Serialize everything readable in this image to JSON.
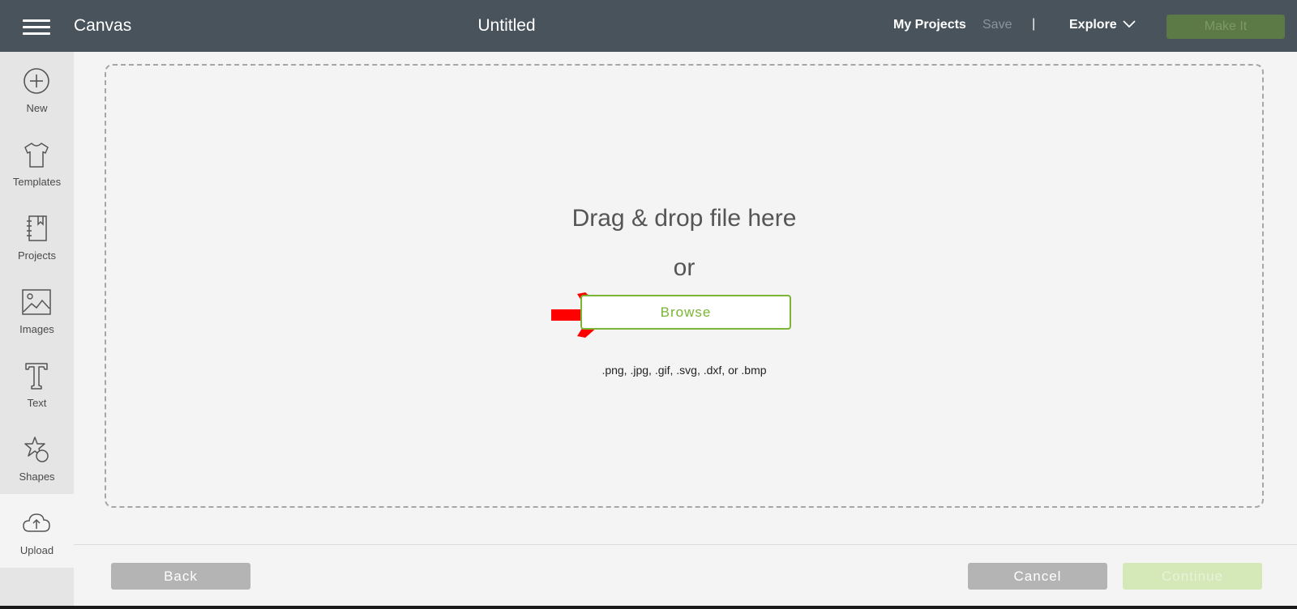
{
  "header": {
    "app_title": "Canvas",
    "doc_title": "Untitled",
    "my_projects": "My Projects",
    "save": "Save",
    "divider": "|",
    "explore": "Explore",
    "make_it": "Make It"
  },
  "sidebar": {
    "items": [
      {
        "label": "New",
        "icon": "plus-circle-icon"
      },
      {
        "label": "Templates",
        "icon": "tshirt-icon"
      },
      {
        "label": "Projects",
        "icon": "notebook-icon"
      },
      {
        "label": "Images",
        "icon": "image-icon"
      },
      {
        "label": "Text",
        "icon": "text-icon"
      },
      {
        "label": "Shapes",
        "icon": "shapes-icon"
      },
      {
        "label": "Upload",
        "icon": "cloud-upload-icon",
        "active": true
      }
    ]
  },
  "upload": {
    "drag_text": "Drag & drop file here",
    "or_text": "or",
    "browse": "Browse",
    "formats": ".png, .jpg, .gif, .svg, .dxf, or .bmp"
  },
  "footer": {
    "back": "Back",
    "cancel": "Cancel",
    "continue": "Continue"
  },
  "colors": {
    "header_bg": "#48535b",
    "accent_green": "#7ab534",
    "annotation_arrow": "#ff0000"
  }
}
